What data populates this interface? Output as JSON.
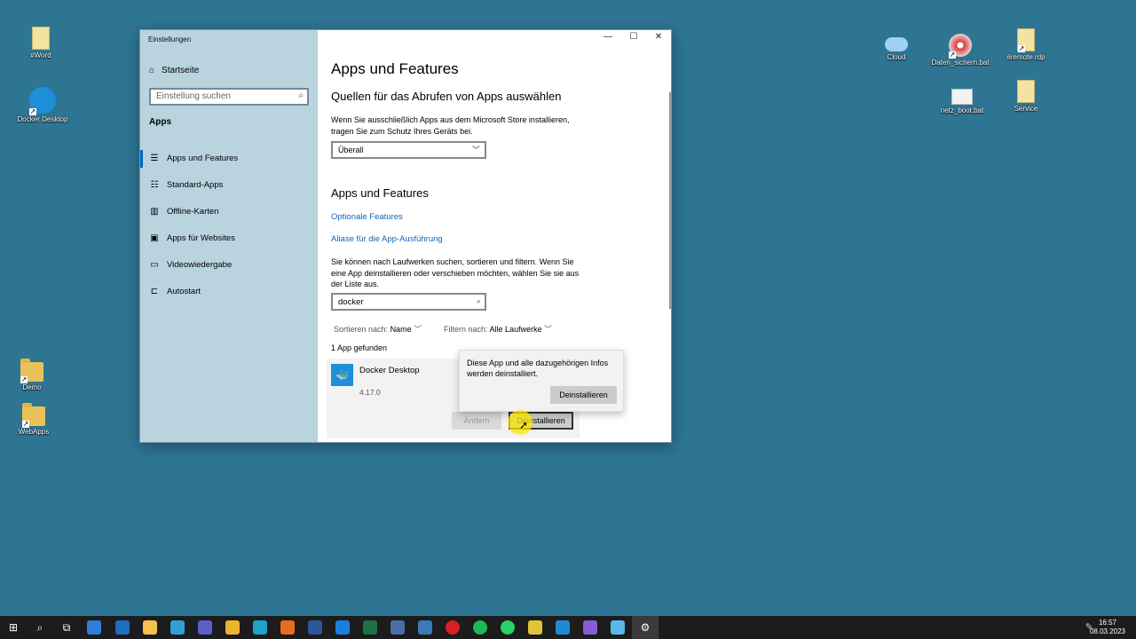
{
  "desktop": {
    "icons": [
      {
        "label": "#Word",
        "icon": "document-icon"
      },
      {
        "label": "Docker Desktop",
        "icon": "docker-icon"
      },
      {
        "label": "Demo",
        "icon": "folder-icon"
      },
      {
        "label": "WebApps",
        "icon": "folder-icon"
      },
      {
        "label": "Cloud",
        "icon": "cloud-icon"
      },
      {
        "label": "Daten_sichern.bat",
        "icon": "cd-icon"
      },
      {
        "label": "#remote.rdp",
        "icon": "document-icon"
      },
      {
        "label": "netz_boot.bat",
        "icon": "gears-icon"
      },
      {
        "label": "Service",
        "icon": "document-icon"
      }
    ]
  },
  "window": {
    "title": "Einstellungen",
    "controls": {
      "minimize": "—",
      "maximize": "☐",
      "close": "✕"
    }
  },
  "sidebar": {
    "home_label": "Startseite",
    "search_placeholder": "Einstellung suchen",
    "category": "Apps",
    "items": [
      {
        "label": "Apps und Features",
        "icon": "list-icon",
        "active": true
      },
      {
        "label": "Standard-Apps",
        "icon": "default-apps-icon",
        "active": false
      },
      {
        "label": "Offline-Karten",
        "icon": "map-icon",
        "active": false
      },
      {
        "label": "Apps für Websites",
        "icon": "web-apps-icon",
        "active": false
      },
      {
        "label": "Videowiedergabe",
        "icon": "video-icon",
        "active": false
      },
      {
        "label": "Autostart",
        "icon": "startup-icon",
        "active": false
      }
    ]
  },
  "main": {
    "title": "Apps und Features",
    "source_heading": "Quellen für das Abrufen von Apps auswählen",
    "source_text": "Wenn Sie ausschließlich Apps aus dem Microsoft Store installieren, tragen Sie zum Schutz Ihres Geräts bei.",
    "source_value": "Überall",
    "section_heading": "Apps und Features",
    "link_optional": "Optionale Features",
    "link_alias": "Aliase für die App-Ausführung",
    "search_text": "Sie können nach Laufwerken suchen, sortieren und filtern. Wenn Sie eine App deinstallieren oder verschieben möchten, wählen Sie sie aus der Liste aus.",
    "search_value": "docker",
    "sort_label": "Sortieren nach:",
    "sort_value": "Name",
    "filter_label": "Filtern nach:",
    "filter_value": "Alle Laufwerke",
    "found_text": "1 App gefunden",
    "app": {
      "name": "Docker Desktop",
      "version": "4.17.0",
      "modify_label": "Ändern",
      "uninstall_label": "Deinstallieren"
    },
    "flyout": {
      "message": "Diese App und alle dazugehörigen Infos werden deinstalliert.",
      "confirm_label": "Deinstallieren"
    }
  },
  "taskbar": {
    "time": "16:57",
    "date": "08.03.2023",
    "apps": [
      {
        "name": "start-icon",
        "color": "#ffffff"
      },
      {
        "name": "search-icon",
        "color": "#ffffff"
      },
      {
        "name": "task-view-icon",
        "color": "#ffffff"
      },
      {
        "name": "widgets-icon",
        "color": "#2f7fd6"
      },
      {
        "name": "outlook-icon",
        "color": "#1b6ec2"
      },
      {
        "name": "explorer-icon",
        "color": "#f2c24b"
      },
      {
        "name": "remote-icon",
        "color": "#2f9fd6"
      },
      {
        "name": "teams-icon",
        "color": "#5b5fc7"
      },
      {
        "name": "chrome-icon",
        "color": "#e9b42e"
      },
      {
        "name": "edge-icon",
        "color": "#1fa2c9"
      },
      {
        "name": "firefox-icon",
        "color": "#e86b1f"
      },
      {
        "name": "word-icon",
        "color": "#2b579a"
      },
      {
        "name": "teamviewer-icon",
        "color": "#1b7fe0"
      },
      {
        "name": "excel-icon",
        "color": "#1f7244"
      },
      {
        "name": "rdp-icon",
        "color": "#4a6fa5"
      },
      {
        "name": "pen-icon",
        "color": "#3c7ab8"
      },
      {
        "name": "recorder-icon",
        "color": "#d82020"
      },
      {
        "name": "spotify-icon",
        "color": "#1db954"
      },
      {
        "name": "whatsapp-icon",
        "color": "#25d366"
      },
      {
        "name": "notes-icon",
        "color": "#e2c33a"
      },
      {
        "name": "vscode-icon",
        "color": "#1f8ad2"
      },
      {
        "name": "visual-studio-icon",
        "color": "#8a5bd6"
      },
      {
        "name": "azure-icon",
        "color": "#5ab8e8"
      },
      {
        "name": "settings-icon",
        "color": "#ffffff"
      }
    ]
  }
}
